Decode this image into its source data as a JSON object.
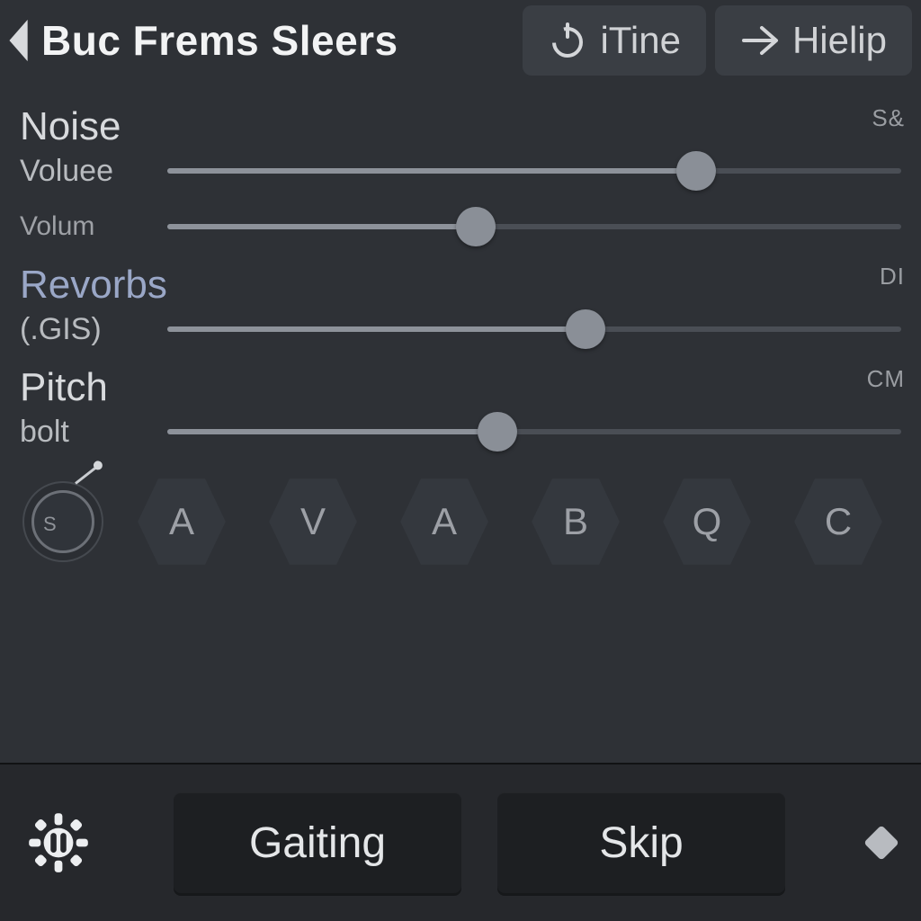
{
  "header": {
    "title": "Buc Frems Sleers",
    "btn1": {
      "label": "iTine"
    },
    "btn2": {
      "label": "Hielip"
    }
  },
  "sliders": {
    "group1": {
      "title": "Noise",
      "row_label": "Voluee",
      "end": "S&",
      "value_pct": 72
    },
    "row2": {
      "row_label": "Volum",
      "value_pct": 42
    },
    "group3": {
      "title": "Revorbs",
      "row_label": "(.GIS)",
      "end": "DI",
      "value_pct": 57
    },
    "group4": {
      "title": "Pitch",
      "row_label": "bolt",
      "end": "CM",
      "value_pct": 45
    }
  },
  "knob": {
    "glyph": "S"
  },
  "keys": [
    "A",
    "V",
    "A",
    "B",
    "Q",
    "C"
  ],
  "footer": {
    "btn1": "Gaiting",
    "btn2": "Skip"
  }
}
